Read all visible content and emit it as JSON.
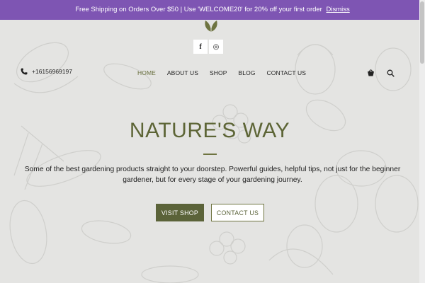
{
  "promo": {
    "text": "Free Shipping on Orders Over $50 | Use 'WELCOME20' for 20% off your first order",
    "dismiss": "Dismiss"
  },
  "social": {
    "facebook_glyph": "f",
    "instagram_glyph": "◎"
  },
  "header": {
    "phone": "+16156969197",
    "nav": [
      {
        "label": "HOME",
        "active": true
      },
      {
        "label": "ABOUT US",
        "active": false
      },
      {
        "label": "SHOP",
        "active": false
      },
      {
        "label": "BLOG",
        "active": false
      },
      {
        "label": "CONTACT US",
        "active": false
      }
    ]
  },
  "hero": {
    "title": "NATURE'S WAY",
    "text": "Some of the best gardening products straight to your doorstep. Powerful guides, helpful tips, not just for the beginner gardener, but for every stage of your gardening journey.",
    "primary_button": "VISIT SHOP",
    "secondary_button": "CONTACT US"
  },
  "colors": {
    "promo_bg": "#7e55b3",
    "accent_olive": "#5b6339",
    "page_bg": "#e4e4e2"
  },
  "icons": [
    "leaf-logo-icon",
    "facebook-icon",
    "instagram-icon",
    "phone-icon",
    "cart-icon",
    "search-icon"
  ]
}
